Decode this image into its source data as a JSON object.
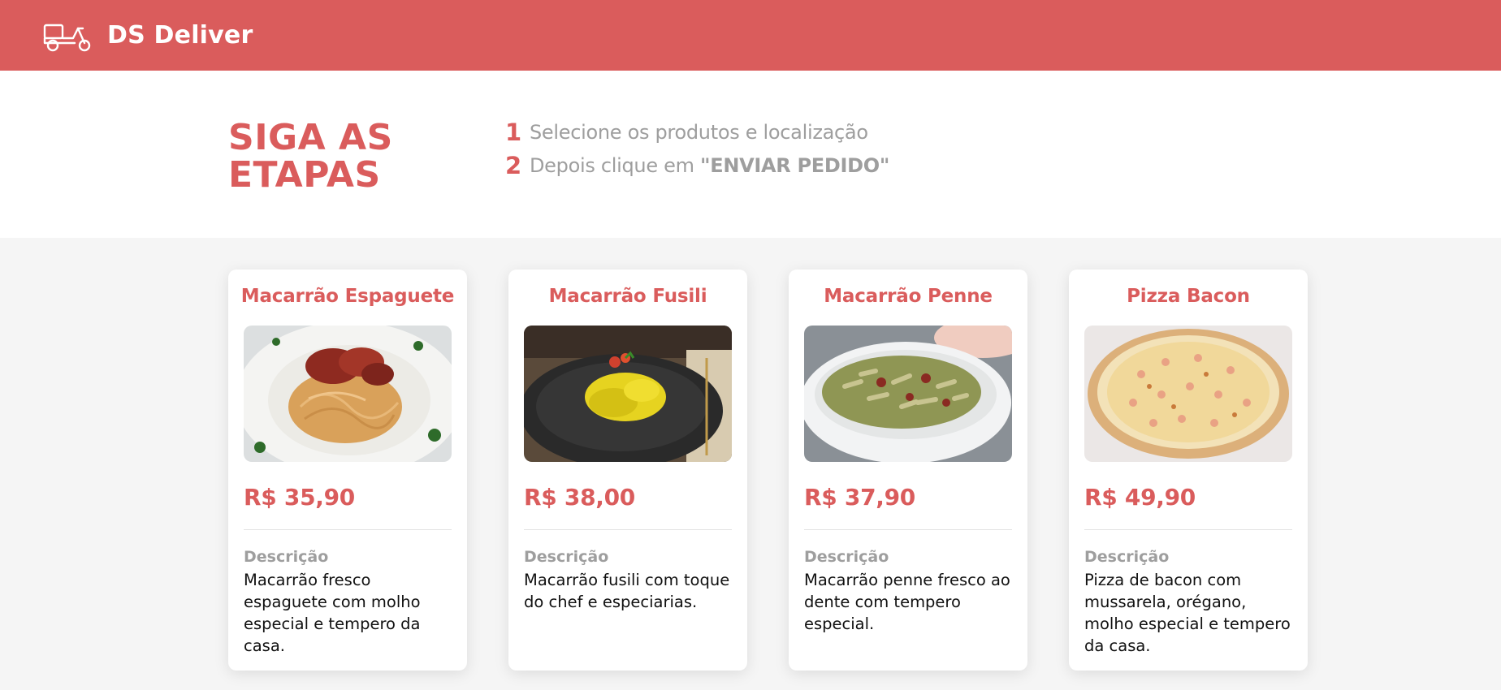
{
  "navbar": {
    "brand": "DS Deliver",
    "logo_icon": "delivery-scooter-icon",
    "background": "#da5c5c"
  },
  "steps": {
    "title_line1": "SIGA AS",
    "title_line2": "ETAPAS",
    "items": [
      {
        "number": "1",
        "text": "Selecione os produtos e localização",
        "strong": ""
      },
      {
        "number": "2",
        "text": "Depois clique em ",
        "strong": "\"ENVIAR PEDIDO\""
      }
    ]
  },
  "products": [
    {
      "name": "Macarrão Espaguete",
      "price": "R$ 35,90",
      "description_label": "Descrição",
      "description": "Macarrão fresco espaguete com molho especial e tempero da casa."
    },
    {
      "name": "Macarrão Fusili",
      "price": "R$ 38,00",
      "description_label": "Descrição",
      "description": "Macarrão fusili com toque do chef e especiarias."
    },
    {
      "name": "Macarrão Penne",
      "price": "R$ 37,90",
      "description_label": "Descrição",
      "description": "Macarrão penne fresco ao dente com tempero especial."
    },
    {
      "name": "Pizza Bacon",
      "price": "R$ 49,90",
      "description_label": "Descrição",
      "description": "Pizza de bacon com mussarela, orégano, molho especial e tempero da casa."
    }
  ],
  "colors": {
    "accent": "#da5c5c",
    "muted_text": "#9e9e9e",
    "page_background": "#f5f5f5",
    "card_background": "#ffffff"
  }
}
